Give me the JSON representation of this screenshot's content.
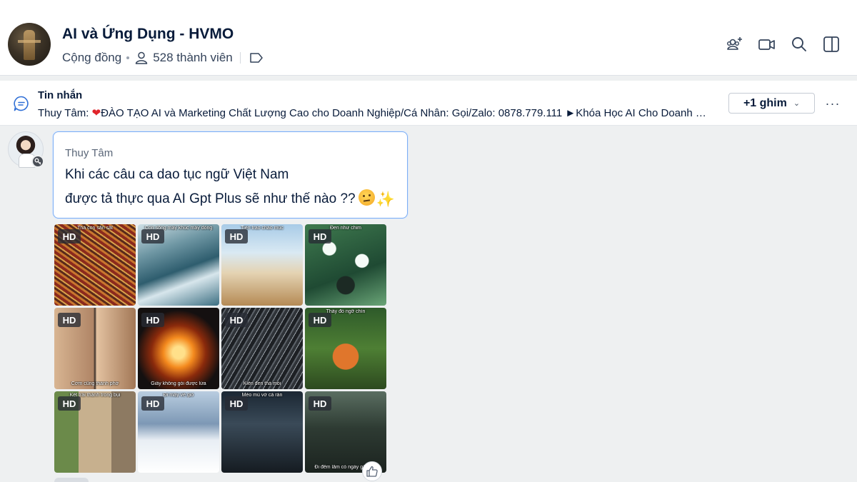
{
  "header": {
    "group_name": "AI và Ứng Dụng - HVMO",
    "group_type": "Cộng đồng",
    "member_count": "528 thành viên",
    "icons": [
      "add-member-icon",
      "video-call-icon",
      "search-icon",
      "sidebar-toggle-icon"
    ]
  },
  "pinned": {
    "title": "Tin nhắn",
    "sender": "Thuy Tâm:",
    "message": "ĐÀO TẠO AI và Marketing Chất Lượng Cao cho Doanh Nghiệp/Cá Nhân: Gọi/Zalo: 0878.779.111 ►Khóa Học AI Cho Doanh Nghiệp",
    "heart_color": "#e0242a",
    "pins_button": "+1 ghim",
    "more": "···"
  },
  "message": {
    "sender": "Thuy Tâm",
    "line1": "Khi các câu ca dao tục ngữ Việt Nam",
    "line2": "được tả thực qua AI Gpt Plus sẽ như thế nào  ??",
    "accent_color": "#7eaef2"
  },
  "photos": [
    {
      "badge": "HD",
      "caption": "Thả con săn sắt"
    },
    {
      "badge": "HD",
      "caption": "Con sông mấy khúc mấy dòng"
    },
    {
      "badge": "HD",
      "caption": "Tiền trao cháo múc"
    },
    {
      "badge": "HD",
      "caption": "Đen như chim"
    },
    {
      "badge": "HD",
      "caption": "Cơm cũng thành phở"
    },
    {
      "badge": "HD",
      "caption": "Giấy không gói được lửa"
    },
    {
      "badge": "HD",
      "caption": "Kiến đen thả mồi"
    },
    {
      "badge": "HD",
      "caption": "Thấy đỏ ngỡ chín"
    },
    {
      "badge": "HD",
      "caption": "Kết trái thành trong bụi"
    },
    {
      "badge": "HD",
      "caption": "Đi mây về gió"
    },
    {
      "badge": "HD",
      "caption": "Mèo mù vớ cá rán"
    },
    {
      "badge": "HD",
      "caption": "Đi đêm lắm có ngày gặp ma"
    }
  ]
}
